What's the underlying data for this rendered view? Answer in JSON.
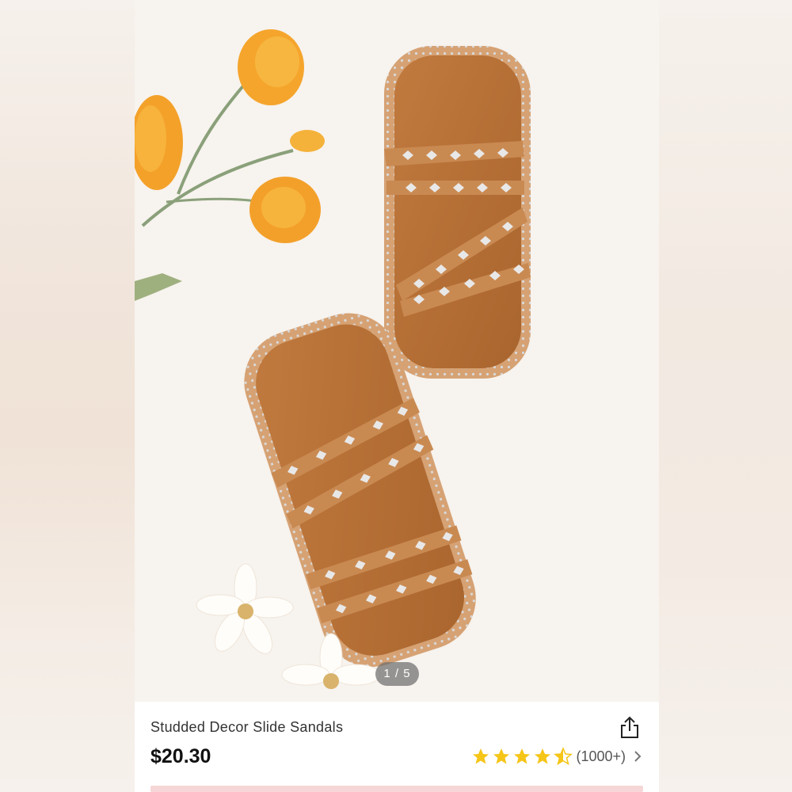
{
  "product": {
    "title": "Studded Decor Slide Sandals",
    "price": "$20.30",
    "rating": 4.5,
    "rating_count": "(1000+)"
  },
  "gallery": {
    "indicator": "1 / 5"
  },
  "icons": {
    "share": "share-icon",
    "star": "star-icon",
    "chevron": "chevron-right-icon"
  },
  "colors": {
    "star": "#f5c518",
    "sandal": "#b56f37",
    "background": "#f7f3ee"
  }
}
